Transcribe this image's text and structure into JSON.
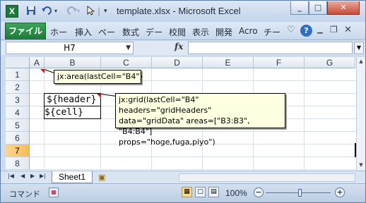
{
  "window": {
    "title": "template.xlsx  -  Microsoft Excel",
    "app_icon_letter": "X",
    "controls": {
      "minimize": "_",
      "maximize": "□",
      "close": "✕"
    }
  },
  "quick_access": {
    "save_icon": "save-icon",
    "undo_icon": "undo-icon",
    "redo_icon": "redo-icon",
    "pointer_icon": "pointer-icon",
    "customize_icon": "customize-icon"
  },
  "ribbon": {
    "file_tab": "ファイル",
    "tabs": [
      "ホー",
      "挿入",
      "ペー",
      "数式",
      "デー",
      "校閲",
      "表示",
      "開発",
      "Acro",
      "チー"
    ]
  },
  "formula_bar": {
    "name_box": "H7",
    "fx_label": "fx",
    "formula": ""
  },
  "columns": [
    "A",
    "B",
    "C",
    "D",
    "E",
    "F",
    "G"
  ],
  "rows": [
    "1",
    "2",
    "3",
    "4",
    "5",
    "6",
    "7",
    "8"
  ],
  "selected": {
    "cell": "H7",
    "row": "7"
  },
  "cells": {
    "B3": "${header}",
    "B4": "${cell}"
  },
  "comments": {
    "A1": "jx:area(lastCell=\"B4\")",
    "B3": [
      "jx:grid(lastCell=\"B4\" headers=\"gridHeaders\"",
      "data=\"gridData\" areas=[\"B3:B3\", \"B4:B4\"]",
      "props=\"hoge,fuga,piyo\")"
    ]
  },
  "sheets": {
    "active": "Sheet1"
  },
  "status": {
    "mode": "コマンド",
    "zoom": "100%",
    "zoom_minus": "−",
    "zoom_plus": "+"
  },
  "colors": {
    "file_tab": "#1c7a38",
    "selected_row": "#f6bd57",
    "comment_bg": "#ffffe1",
    "comment_indicator": "#d01818"
  }
}
